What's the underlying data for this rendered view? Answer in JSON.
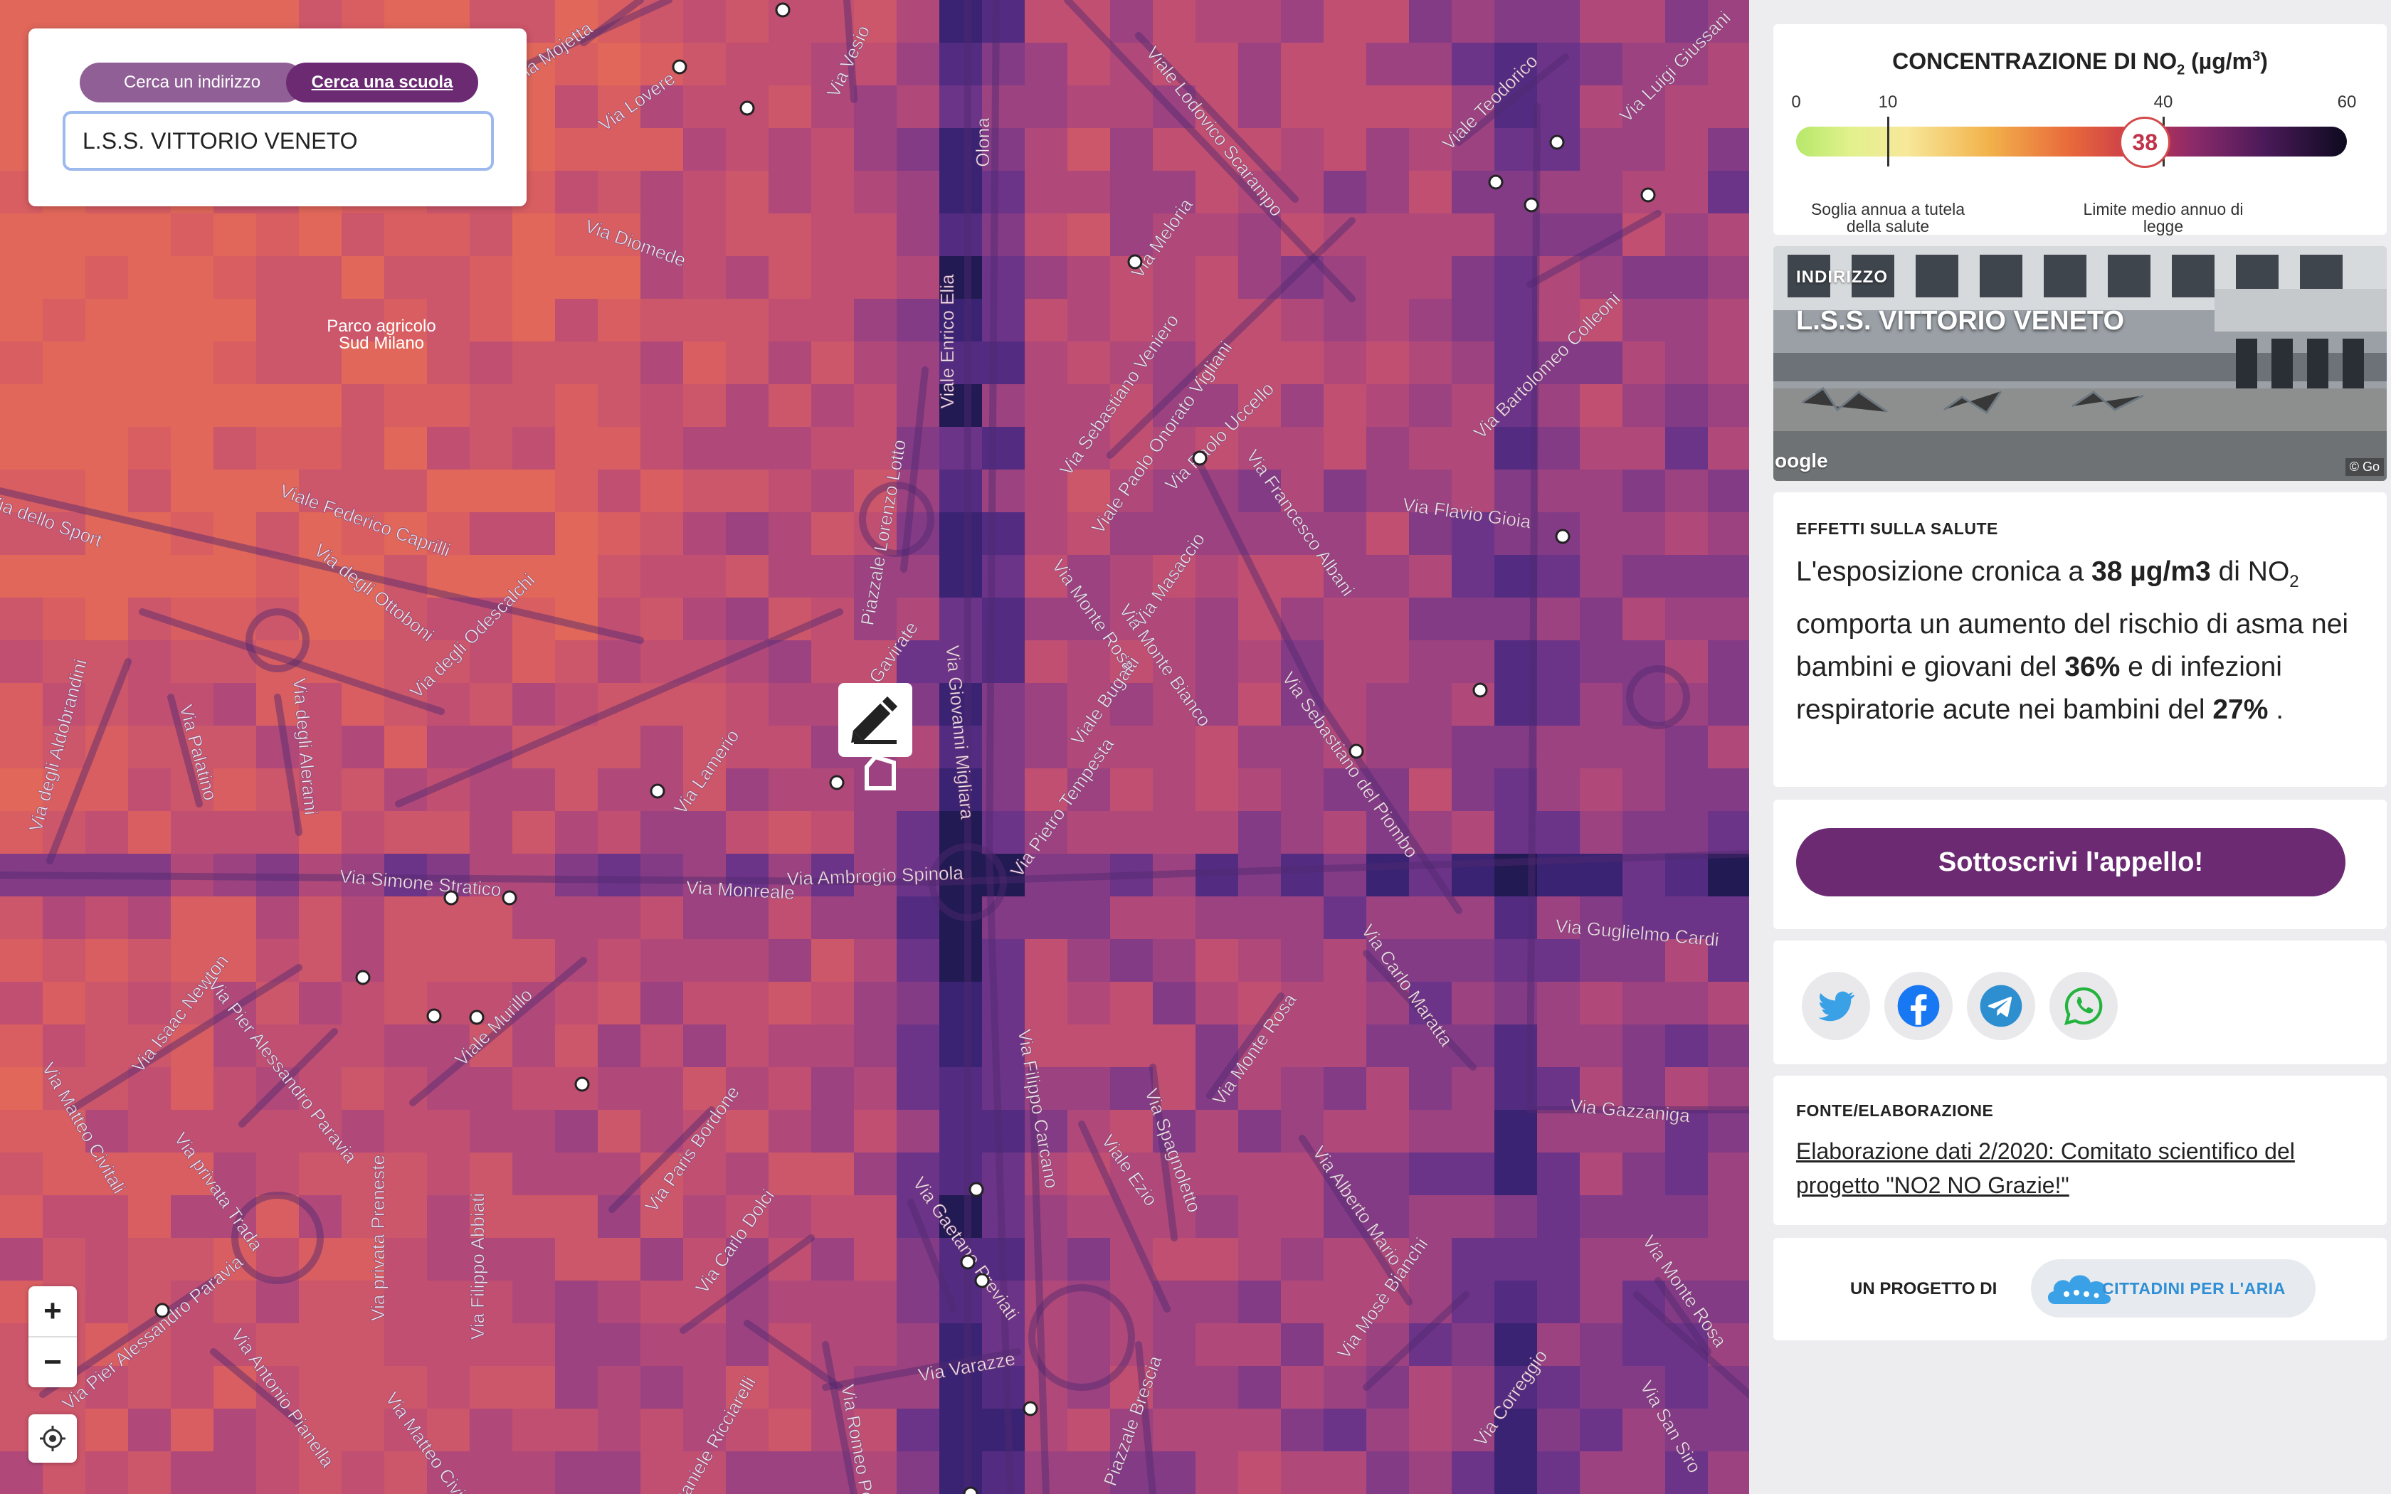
{
  "search": {
    "tab_address": "Cerca un indirizzo",
    "tab_school": "Cerca una scuola",
    "query": "L.S.S. VITTORIO VENETO"
  },
  "map": {
    "zoom_in": "+",
    "zoom_out": "−",
    "park_label_1": "Parco agricolo",
    "park_label_2": "Sud Milano",
    "streets": [
      "Via Cascina Mojetta",
      "Via Lovere",
      "Via Vesio",
      "Viale Lodovico Scarampo",
      "Viale Teodorico",
      "Via Luigi Giussani",
      "Olona",
      "Via Diomede",
      "Via Meloria",
      "Via Sebastiano Veniero",
      "Viale Paolo Onorato Vigliani",
      "Viale Enrico Elia",
      "Via Bartolomeo Colleoni",
      "Via Paolo Uccello",
      "Piazzale Lorenzo Lotto",
      "Viale Federico Caprilli",
      "Via degli Ottoboni",
      "Via Francesco Albani",
      "Via Flavio Gioia",
      "Via degli Odescalchi",
      "Via Masaccio",
      "Viale Bugatti",
      "Via Monte Rosa",
      "Via Monte Bianco",
      "Via Gavirate",
      "Via degli Aldobrandini",
      "Via Palatino",
      "Via degli Alerami",
      "Via Lamerio",
      "Via Giovanni Migliara",
      "Via Sebastiano del Piombo",
      "Via Pietro Tempesta",
      "Via Simone Stratico",
      "Via Monreale",
      "Via Ambrogio Spinola",
      "Via Guglielmo Cardi",
      "Via Isaac Newton",
      "Via Pier Alessandro Paravia",
      "Viale Murillo",
      "Via Filippo Carcano",
      "Via Monte Rosa",
      "Via Carlo Maratta",
      "Via Paris Bordone",
      "Via Spagnoletto",
      "Viale Ezio",
      "Via Gazzaniga",
      "Via Matteo Civitali",
      "Via privata Trada",
      "Via privata Preneste",
      "Via Filippo Abbiati",
      "Via Carlo Dolci",
      "Via Gaetano Previati",
      "Via Mosè Bianchi",
      "Via Alberto Mario",
      "Via Monte Rosa",
      "Via Antonio Pianella",
      "Via Matteo Civitali",
      "Via Daniele Ricciarelli",
      "Via Romeo Pozzo",
      "Via Varazze",
      "Piazzale Brescia",
      "Via Correggio",
      "Via San Siro",
      "Via Pier Alessandro Paravia",
      "Via dello Sport"
    ]
  },
  "legend": {
    "title": "CONCENTRAZIONE DI NO",
    "title_sub": "2",
    "title_unit_pre": " (µg/m",
    "title_unit_sup": "3",
    "title_unit_post": ")",
    "ticks": [
      "0",
      "10",
      "40",
      "60"
    ],
    "value": 38,
    "note_left_1": "Soglia annua a tutela",
    "note_left_2": "della salute",
    "note_right_1": "Limite medio annuo di",
    "note_right_2": "legge"
  },
  "address": {
    "label": "INDIRIZZO",
    "name": "L.S.S. VITTORIO VENETO",
    "photo_logo": "oogle",
    "photo_copy": "© Go"
  },
  "health": {
    "label": "EFFETTI SULLA SALUTE",
    "p1": "L'esposizione cronica a ",
    "value": "38 µg/m3",
    "p2": " di NO",
    "p2_sub": "2",
    "p3": " comporta un aumento del rischio di asma nei bambini e giovani del ",
    "asthma": "36%",
    "p4": " e di infezioni respiratorie acute nei bambini del ",
    "infections": "27%",
    "p5": " ."
  },
  "cta": {
    "label": "Sottoscrivi l'appello!"
  },
  "share": [
    "twitter-icon",
    "facebook-icon",
    "telegram-icon",
    "whatsapp-icon"
  ],
  "source": {
    "label": "FONTE/ELABORAZIONE",
    "link": "Elaborazione dati 2/2020: Comitato scientifico del progetto \"NO2 NO Grazie!\""
  },
  "project": {
    "label": "UN PROGETTO DI",
    "logo_text": "CITTADINI PER L'ARIA"
  }
}
